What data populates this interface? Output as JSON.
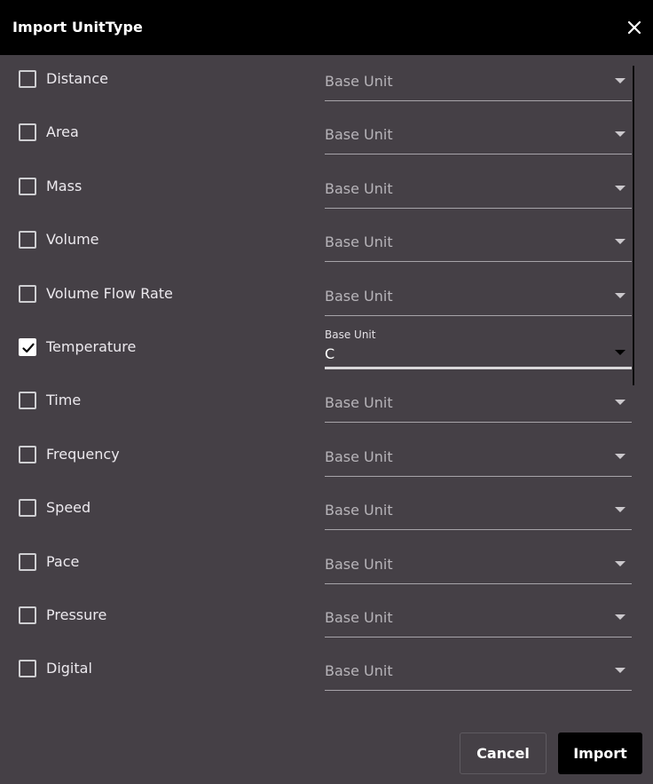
{
  "dialog": {
    "title": "Import UnitType"
  },
  "select_placeholder": "Base Unit",
  "rows": [
    {
      "label": "Distance",
      "checked": false,
      "value": ""
    },
    {
      "label": "Area",
      "checked": false,
      "value": ""
    },
    {
      "label": "Mass",
      "checked": false,
      "value": ""
    },
    {
      "label": "Volume",
      "checked": false,
      "value": ""
    },
    {
      "label": "Volume Flow Rate",
      "checked": false,
      "value": ""
    },
    {
      "label": "Temperature",
      "checked": true,
      "value": "C"
    },
    {
      "label": "Time",
      "checked": false,
      "value": ""
    },
    {
      "label": "Frequency",
      "checked": false,
      "value": ""
    },
    {
      "label": "Speed",
      "checked": false,
      "value": ""
    },
    {
      "label": "Pace",
      "checked": false,
      "value": ""
    },
    {
      "label": "Pressure",
      "checked": false,
      "value": ""
    },
    {
      "label": "Digital",
      "checked": false,
      "value": ""
    }
  ],
  "buttons": {
    "cancel_label": "Cancel",
    "import_label": "Import"
  },
  "icons": {
    "close": "close-icon",
    "check": "check-icon",
    "dropdown": "chevron-down-icon"
  }
}
